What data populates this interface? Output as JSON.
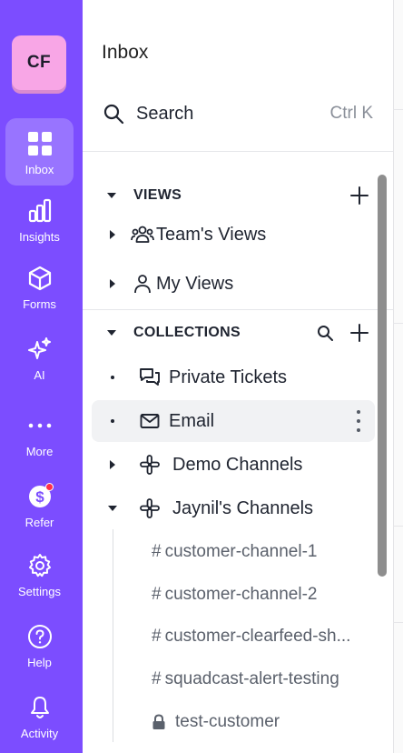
{
  "rail": {
    "avatar_initials": "CF",
    "items": [
      {
        "label": "Inbox",
        "icon": "grid-icon",
        "active": true
      },
      {
        "label": "Insights",
        "icon": "bar-chart-icon"
      },
      {
        "label": "Forms",
        "icon": "cube-icon"
      },
      {
        "label": "AI",
        "icon": "sparkle-icon"
      },
      {
        "label": "More",
        "icon": "ellipsis-icon"
      },
      {
        "label": "Refer",
        "icon": "dollar-badge-icon"
      },
      {
        "label": "Settings",
        "icon": "gear-icon"
      },
      {
        "label": "Help",
        "icon": "question-icon"
      },
      {
        "label": "Activity",
        "icon": "bell-icon"
      }
    ],
    "colors": {
      "background": "#7c4dff",
      "avatar": "#f8a6e6",
      "notification": "#ff2f4a"
    }
  },
  "panel": {
    "title": "Inbox",
    "search": {
      "label": "Search",
      "shortcut": "Ctrl K"
    },
    "views": {
      "header": "VIEWS",
      "items": [
        {
          "label": "Team's Views",
          "icon": "team-icon"
        },
        {
          "label": "My Views",
          "icon": "person-icon"
        }
      ]
    },
    "collections": {
      "header": "COLLECTIONS",
      "items": [
        {
          "label": "Private Tickets",
          "icon": "chat-bubbles-icon"
        },
        {
          "label": "Email",
          "icon": "mail-icon"
        },
        {
          "label": "Demo Channels",
          "icon": "slack-icon"
        },
        {
          "label": "Jaynil's Channels",
          "icon": "slack-icon"
        }
      ],
      "channels": [
        {
          "prefix": "#",
          "label": "customer-channel-1"
        },
        {
          "prefix": "#",
          "label": "customer-channel-2"
        },
        {
          "prefix": "#",
          "label": "customer-clearfeed-sh..."
        },
        {
          "prefix": "#",
          "label": "squadcast-alert-testing"
        },
        {
          "prefix": "",
          "label": "test-customer",
          "icon": "lock-icon"
        }
      ]
    }
  }
}
